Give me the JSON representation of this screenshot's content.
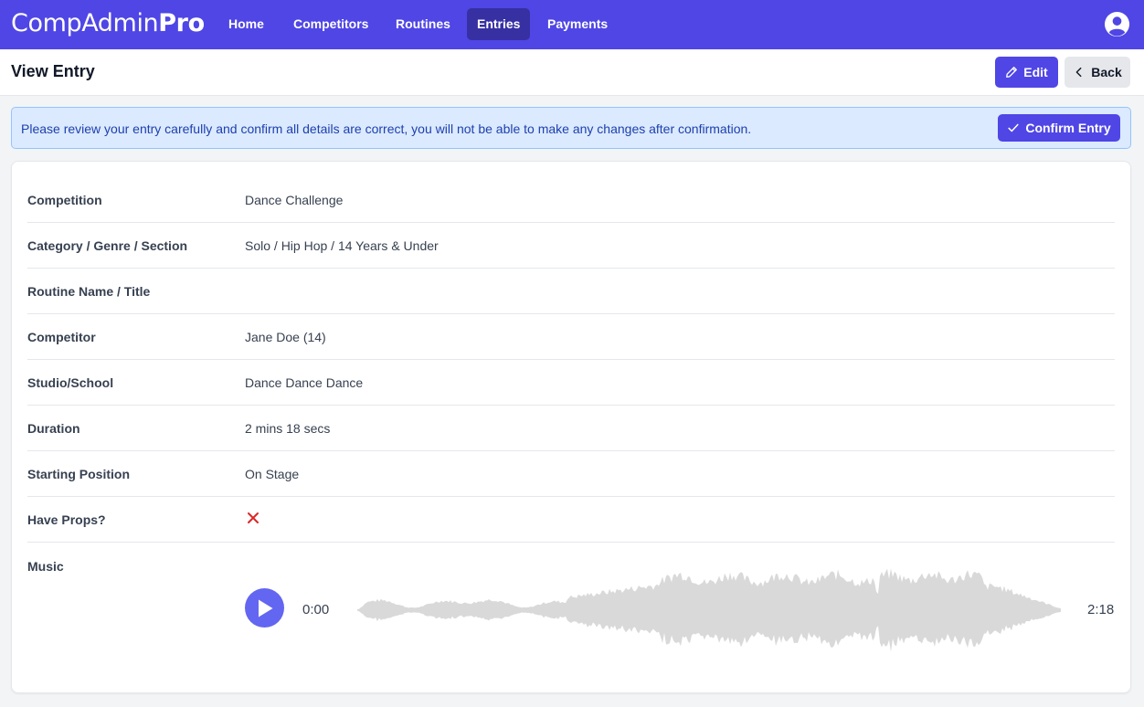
{
  "app": {
    "logo_regular": "CompAdmin",
    "logo_bold": "Pro"
  },
  "nav": {
    "items": [
      {
        "label": "Home"
      },
      {
        "label": "Competitors"
      },
      {
        "label": "Routines"
      },
      {
        "label": "Entries",
        "active": true
      },
      {
        "label": "Payments"
      }
    ],
    "user_icon": "user-circle-icon"
  },
  "header": {
    "title": "View Entry",
    "edit_label": "Edit",
    "back_label": "Back"
  },
  "alert": {
    "message": "Please review your entry carefully and confirm all details are correct, you will not be able to make any changes after confirmation.",
    "confirm_label": "Confirm Entry"
  },
  "details": [
    {
      "label": "Competition",
      "value": "Dance Challenge"
    },
    {
      "label": "Category / Genre / Section",
      "value": "Solo / Hip Hop / 14 Years & Under"
    },
    {
      "label": "Routine Name / Title",
      "value": ""
    },
    {
      "label": "Competitor",
      "value": "Jane Doe (14)"
    },
    {
      "label": "Studio/School",
      "value": "Dance Dance Dance"
    },
    {
      "label": "Duration",
      "value": "2 mins 18 secs"
    },
    {
      "label": "Starting Position",
      "value": "On Stage"
    },
    {
      "label": "Have Props?",
      "value": "",
      "icon": "x-icon"
    }
  ],
  "music": {
    "label": "Music",
    "current_time": "0:00",
    "total_time": "2:18",
    "progress": 0
  },
  "colors": {
    "primary": "#4f46e5",
    "nav_active": "#3730a3",
    "alert_bg": "#dbeafe",
    "alert_text": "#1e40af",
    "play_button": "#6366f1",
    "waveform": "#d9d9d9",
    "x_mark": "#dc2626"
  }
}
